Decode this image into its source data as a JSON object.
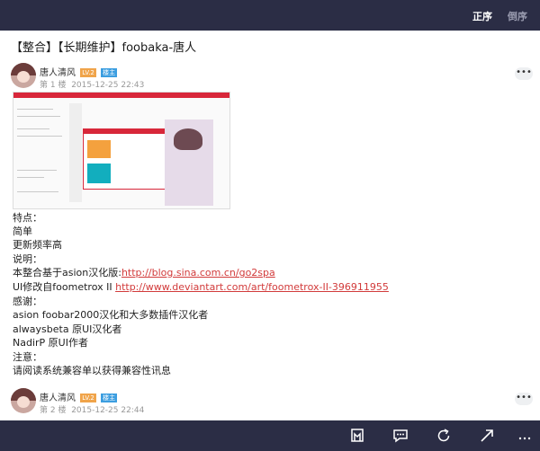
{
  "topbar": {
    "sort_asc": "正序",
    "sort_desc": "倒序"
  },
  "thread": {
    "title": "【整合】【长期维护】foobaka-唐人"
  },
  "posts": [
    {
      "author": "唐人清风",
      "level": "LV.2",
      "role": "楼主",
      "floor": "第 1 楼",
      "time": "2015-12-25 22:43",
      "more": "•••"
    },
    {
      "author": "唐人清风",
      "level": "LV.2",
      "role": "楼主",
      "floor": "第 2 楼",
      "time": "2015-12-25 22:44",
      "more": "•••"
    }
  ],
  "body": {
    "features_label": "特点：",
    "feature_1": "简单",
    "feature_2": "更新频率高",
    "notes_label": "说明：",
    "note_1_prefix": "本整合基于asion汉化版:",
    "note_1_link": "http://blog.sina.com.cn/go2spa",
    "note_2_prefix": "UI修改自foometrox II ",
    "note_2_link": "http://www.deviantart.com/art/foometrox-II-396911955",
    "thanks_label": "感谢：",
    "thanks_1": "asion foobar2000汉化和大多数插件汉化者",
    "thanks_2": "alwaysbeta 原UI汉化者",
    "thanks_3": "NadirP 原UI作者",
    "attention_label": "注意：",
    "attention_1": "请阅读系统兼容单以获得兼容性讯息"
  },
  "icons": {
    "bottom": [
      "bookmark-icon",
      "comment-icon",
      "refresh-icon",
      "share-icon",
      "more-icon"
    ]
  },
  "colors": {
    "bar": "#2b2d45",
    "link": "#d23b3b",
    "level_badge": "#f0a44a",
    "role_badge": "#3c9ee0"
  }
}
